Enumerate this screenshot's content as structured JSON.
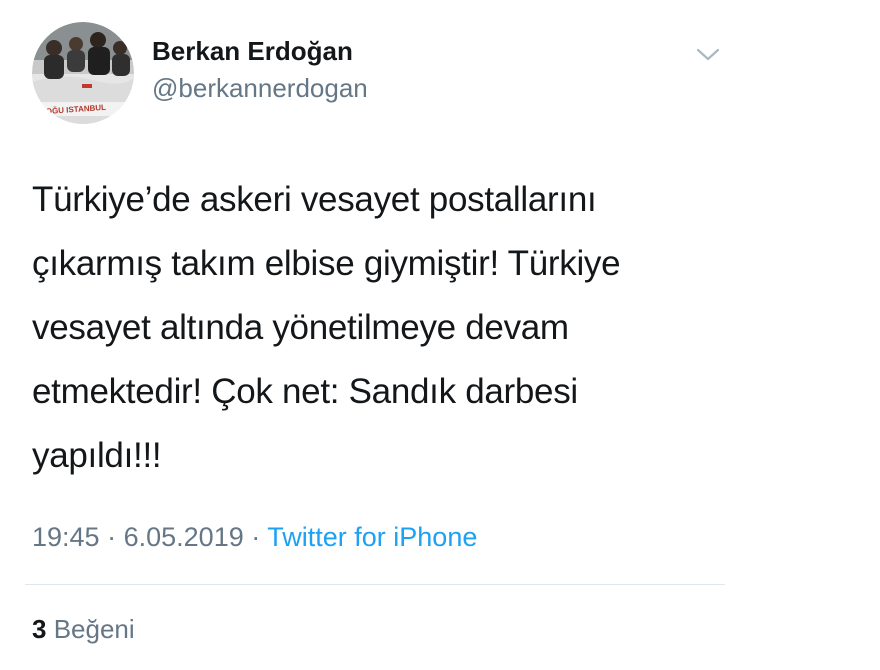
{
  "author": {
    "display_name": "Berkan Erdoğan",
    "handle": "@berkannerdogan",
    "avatar_caption": "OĞU ISTANBUL"
  },
  "menu": {
    "icon": "chevron-down-icon"
  },
  "tweet": {
    "text": "Türkiye’de askeri vesayet postallarını\nçıkarmış takım elbise giymiştir! Türkiye\nvesayet altında yönetilmeye devam\netmektedir! Çok net: Sandık darbesi\nyapıldı!!!",
    "time": "19:45",
    "separator": "·",
    "date": "6.05.2019",
    "source": "Twitter for iPhone"
  },
  "stats": {
    "likes_count": "3",
    "likes_label": "Beğeni"
  },
  "colors": {
    "text": "#14171a",
    "secondary": "#657786",
    "link": "#1da1f2",
    "divider": "#e1e8ed"
  }
}
